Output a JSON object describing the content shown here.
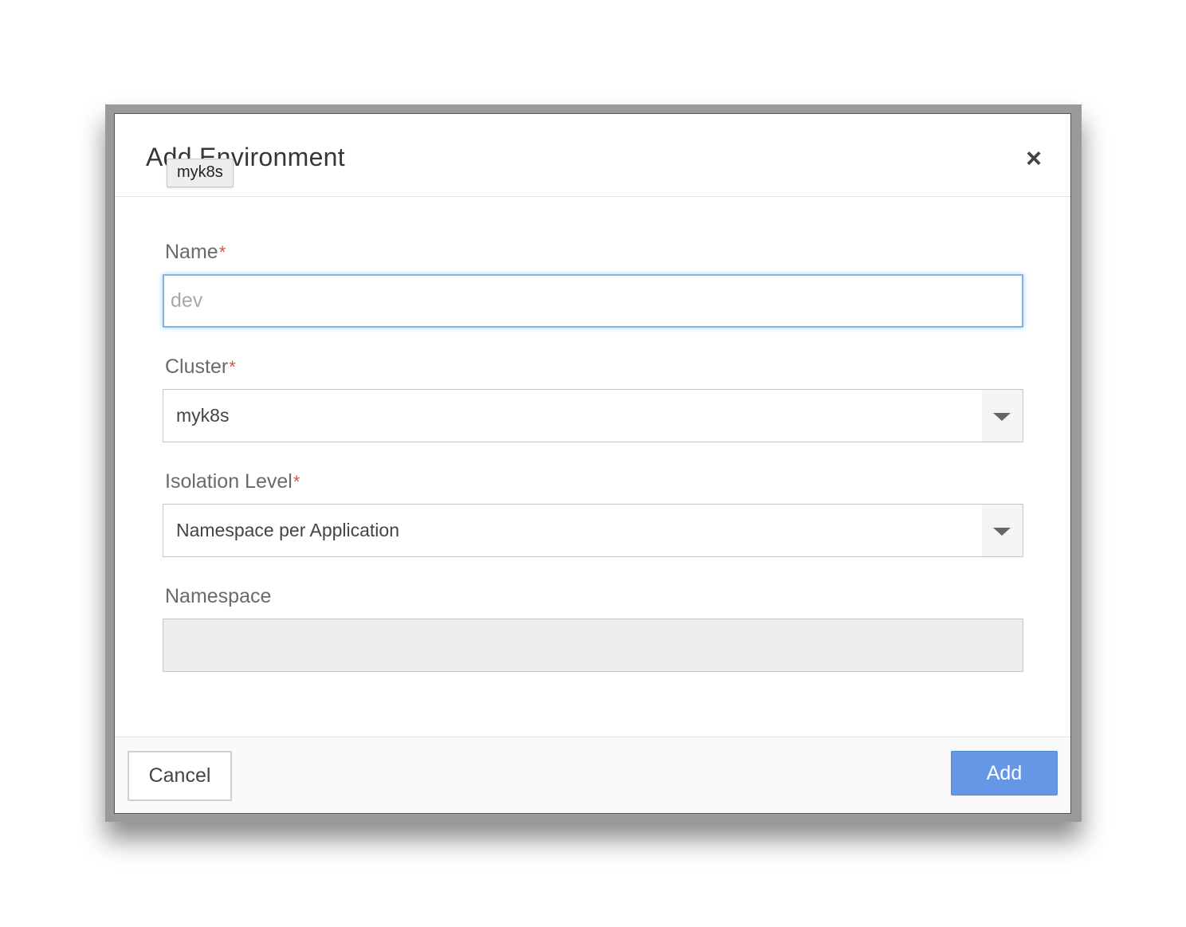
{
  "dialog": {
    "title": "Add Environment",
    "close_glyph": "×",
    "tooltip": "myk8s"
  },
  "form": {
    "name": {
      "label": "Name",
      "required_mark": "*",
      "value": "",
      "placeholder": "dev"
    },
    "cluster": {
      "label": "Cluster",
      "required_mark": "*",
      "selected": "myk8s"
    },
    "isolation_level": {
      "label": "Isolation Level",
      "required_mark": "*",
      "selected": "Namespace per Application"
    },
    "namespace": {
      "label": "Namespace",
      "value": "",
      "disabled": true
    }
  },
  "footer": {
    "cancel_label": "Cancel",
    "add_label": "Add"
  },
  "colors": {
    "primary_button": "#6597e6",
    "required_mark": "#d9534f",
    "focus_border": "#7fb3ec",
    "disabled_field": "#eeeeee"
  },
  "icons": {
    "close": "close-icon",
    "dropdown": "chevron-down-icon"
  }
}
